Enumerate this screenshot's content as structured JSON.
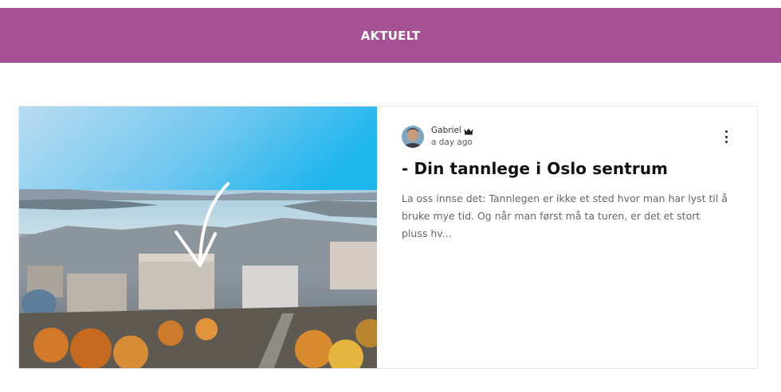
{
  "header": {
    "title": "AKTUELT",
    "background": "#a55193"
  },
  "post": {
    "author": {
      "name": "Gabriel",
      "badge_icon": "crown-icon",
      "time_ago": "a day ago"
    },
    "title": "- Din tannlege i Oslo sentrum",
    "excerpt": "La oss innse det: Tannlegen er ikke et sted hvor man har lyst til å bruke mye tid. Og når man først må ta turen, er det et stort pluss hv...",
    "menu_icon": "more-vertical-icon",
    "cover_image": "aerial-oslo-city-photo"
  }
}
